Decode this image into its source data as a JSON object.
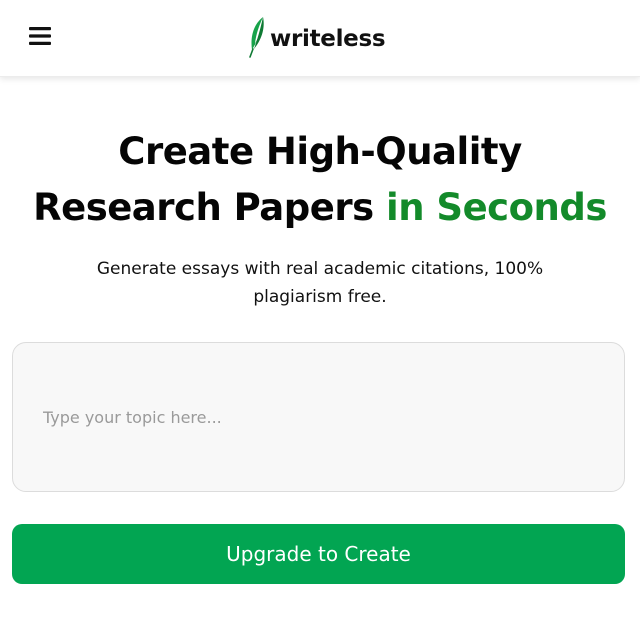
{
  "app": {
    "brand": "writeless",
    "icons": {
      "menu": "hamburger-menu-icon",
      "logo": "quill-feather-icon"
    },
    "colors": {
      "accent": "#138a2a",
      "button": "#02a552",
      "logo_green": "#17a34a"
    }
  },
  "hero": {
    "title_line1": "Create High-Quality",
    "title_line2": "Research Papers",
    "title_accent": "in Seconds",
    "subtitle_line1": "Generate essays with real academic citations, 100%",
    "subtitle_line2": "plagiarism free."
  },
  "form": {
    "topic_placeholder": "Type your topic here...",
    "topic_value": "",
    "submit_label": "Upgrade to Create"
  }
}
